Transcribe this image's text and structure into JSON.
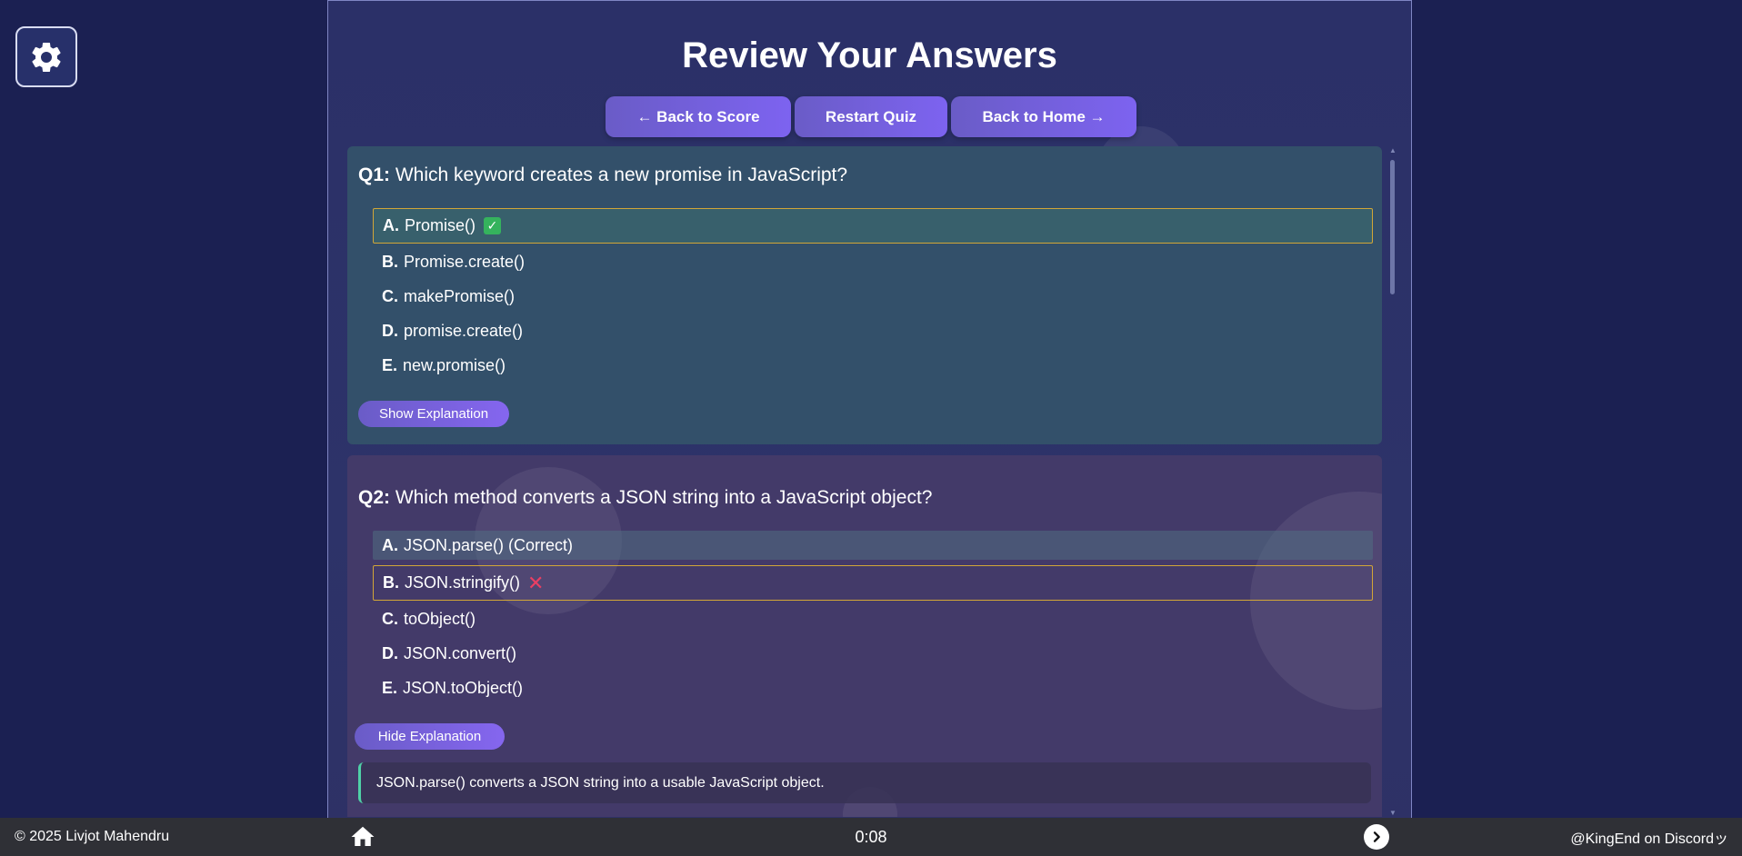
{
  "header": {
    "title": "Review Your Answers",
    "back_to_score": "← Back to Score",
    "restart_quiz": "Restart Quiz",
    "back_to_home": "Back to Home →"
  },
  "questions": [
    {
      "number": "Q1:",
      "text": "Which keyword creates a new promise in JavaScript?",
      "options": [
        {
          "letter": "A.",
          "text": "Promise()",
          "mark": "✓"
        },
        {
          "letter": "B.",
          "text": "Promise.create()"
        },
        {
          "letter": "C.",
          "text": "makePromise()"
        },
        {
          "letter": "D.",
          "text": "promise.create()"
        },
        {
          "letter": "E.",
          "text": "new.promise()"
        }
      ],
      "explanation_button": "Show Explanation"
    },
    {
      "number": "Q2:",
      "text": "Which method converts a JSON string into a JavaScript object?",
      "options": [
        {
          "letter": "A.",
          "text": "JSON.parse() (Correct)"
        },
        {
          "letter": "B.",
          "text": "JSON.stringify()",
          "mark": "✕"
        },
        {
          "letter": "C.",
          "text": "toObject()"
        },
        {
          "letter": "D.",
          "text": "JSON.convert()"
        },
        {
          "letter": "E.",
          "text": "JSON.toObject()"
        }
      ],
      "explanation_button": "Hide Explanation",
      "explanation": "JSON.parse() converts a JSON string into a usable JavaScript object."
    }
  ],
  "footer": {
    "copyright": "© 2025 Livjot Mahendru",
    "timer": "0:08",
    "discord": "@KingEnd on Discordッ"
  },
  "colors": {
    "background": "#1b2052",
    "accent": "#7d63f0",
    "selected_border": "#d2a637",
    "correct": "#35b35d",
    "wrong": "#ea3f63"
  },
  "icons": {
    "settings": "gear-icon",
    "home": "home-icon",
    "next": "chevron-right-icon"
  }
}
